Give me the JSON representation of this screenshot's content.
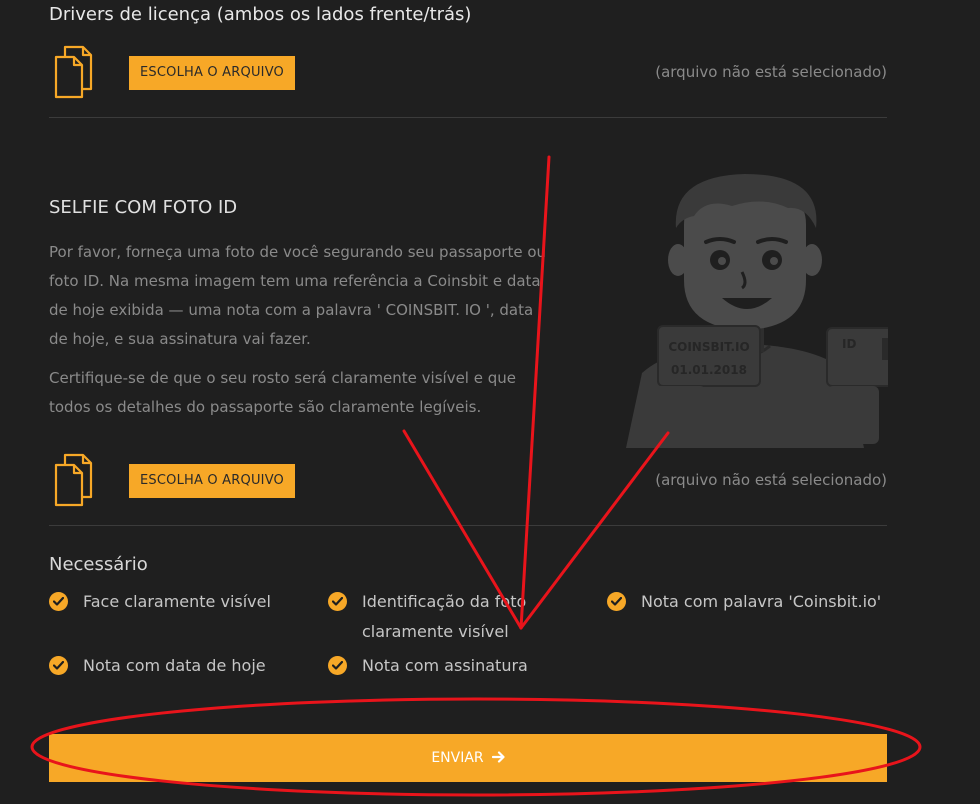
{
  "license": {
    "title": "Drivers de licença (ambos os lados frente/trás)",
    "choose_label": "ESCOLHA O ARQUIVO",
    "status": "(arquivo não está selecionado)"
  },
  "selfie": {
    "title": "SELFIE COM FOTO ID",
    "paragraph1": "Por favor, forneça uma foto de você segurando seu passaporte ou foto ID. Na mesma imagem tem uma referência a Coinsbit e data de hoje exibida — uma nota com a palavra ' COINSBIT. IO ', data de hoje, e sua assinatura vai fazer.",
    "paragraph2": "Certifique-se de que o seu rosto será claramente visível e que todos os detalhes do passaporte são claramente legíveis.",
    "choose_label": "ESCOLHA O ARQUIVO",
    "status": "(arquivo não está selecionado)",
    "illustration": {
      "note_brand": "COINSBIT.IO",
      "note_date": "01.01.2018",
      "id_label": "ID"
    }
  },
  "requirements": {
    "title": "Necessário",
    "items": [
      "Face claramente visível",
      "Identificação da foto claramente visível",
      "Nota com palavra 'Coinsbit.io'",
      "Nota com data de hoje",
      "Nota com assinatura"
    ]
  },
  "submit": {
    "label": "ENVIAR"
  },
  "colors": {
    "background": "#1f1f1f",
    "accent": "#f7a827",
    "muted_text": "#8a8a8a",
    "annotation": "#e8141b"
  },
  "icons": [
    "documents-icon",
    "check-circle-icon",
    "arrow-right-icon"
  ]
}
